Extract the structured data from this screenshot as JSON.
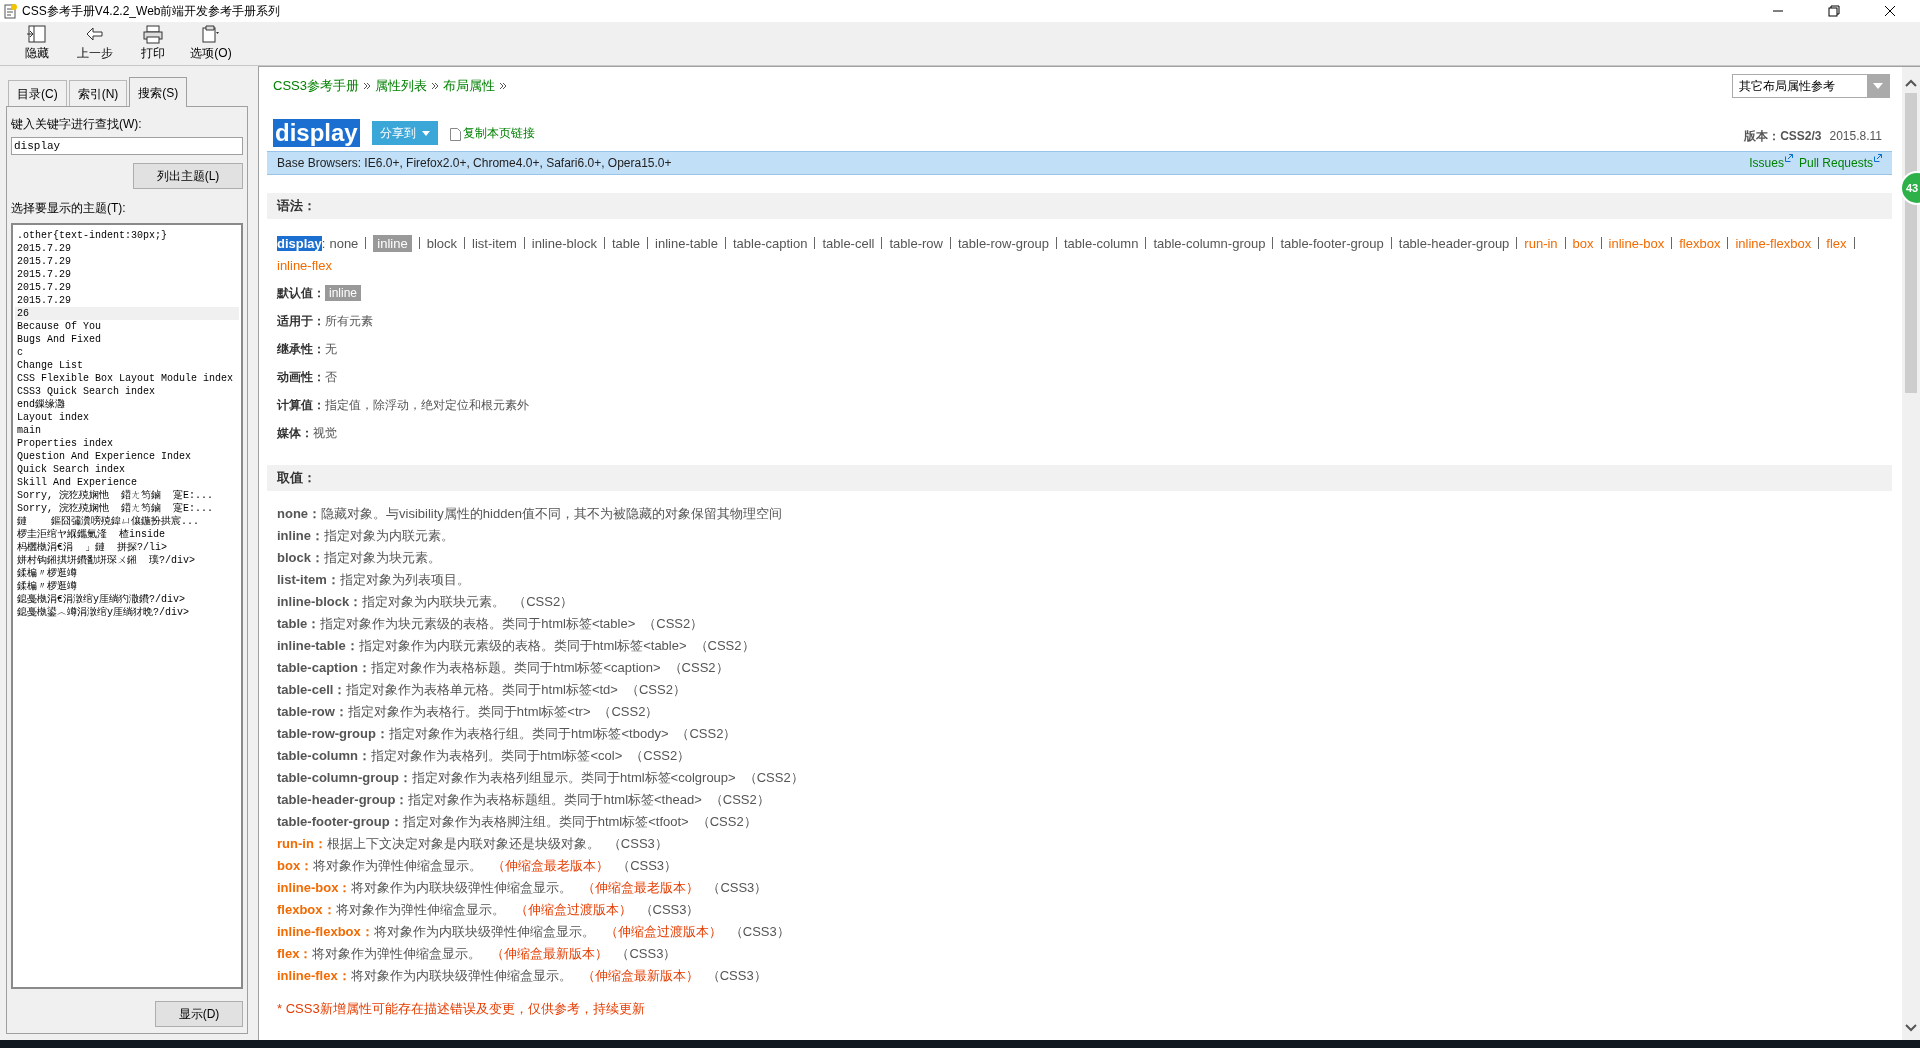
{
  "window": {
    "title": "CSS参考手册V4.2.2_Web前端开发参考手册系列"
  },
  "toolbar": [
    {
      "label": "隐藏"
    },
    {
      "label": "上一步"
    },
    {
      "label": "打印"
    },
    {
      "label": "选项(O)"
    }
  ],
  "nav_tabs": [
    {
      "label": "目录(C)",
      "selected": false
    },
    {
      "label": "索引(N)",
      "selected": false
    },
    {
      "label": "搜索(S)",
      "selected": true
    }
  ],
  "search": {
    "label": "键入关键字进行查找(W):",
    "value": "display",
    "list_button": "列出主题(L)",
    "topics_label": "选择要显示的主题(T):",
    "topics": [
      {
        "text": ".other{text-indent:30px;}",
        "selected": false
      },
      {
        "text": "2015.7.29",
        "selected": false
      },
      {
        "text": "2015.7.29",
        "selected": false
      },
      {
        "text": "2015.7.29",
        "selected": false
      },
      {
        "text": "2015.7.29",
        "selected": false
      },
      {
        "text": "2015.7.29",
        "selected": false
      },
      {
        "text": "26",
        "selected": true
      },
      {
        "text": "Because Of You",
        "selected": false
      },
      {
        "text": "Bugs And Fixed",
        "selected": false
      },
      {
        "text": "c",
        "selected": false
      },
      {
        "text": "Change List",
        "selected": false
      },
      {
        "text": "CSS Flexible Box Layout Module index",
        "selected": false
      },
      {
        "text": "CSS3 Quick Search index",
        "selected": false
      },
      {
        "text": "end鏁缘灉",
        "selected": false
      },
      {
        "text": "Layout index",
        "selected": false
      },
      {
        "text": "main",
        "selected": false
      },
      {
        "text": "Properties index",
        "selected": false
      },
      {
        "text": "Question And Experience Index",
        "selected": false
      },
      {
        "text": "Quick Search index",
        "selected": false
      },
      {
        "text": "Skill And Experience",
        "selected": false
      },
      {
        "text": "Sorry, 浣犵殑娴忚  鍣ㄤ笉鏀  寔E:...",
        "selected": false
      },
      {
        "text": "Sorry, 浣犵殑娴忚  鍣ㄤ笉鏀  寔E:...",
        "selected": false
      },
      {
        "text": "鏈    鏂囧彇瀵嗙殑鍏ㄩ儴鍦扮拱宸...",
        "selected": false
      },
      {
        "text": "椤圭洰绾ヤ緥鑴氭湰  楂inside",
        "selected": false
      },
      {
        "text": "杩欐槸涓€涓  」鏈  拼探?/li>",
        "selected": false
      },
      {
        "text": "姘村钩鎺掑垪鐨勫垪琛ㄨ鎺  璞?/div>",
        "selected": false
      },
      {
        "text": "鍒楄〃椤逛竴",
        "selected": false
      },
      {
        "text": "鍒楄〃椤逛竴",
        "selected": false
      },
      {
        "text": "鎴戞槸涓€涓潡绾у厓绱犳潵鐨?/div>",
        "selected": false
      },
      {
        "text": "鎴戞槸鍙︿竴涓潡绾у厓绱犲晩?/div>",
        "selected": false
      }
    ],
    "display_button": "显示(D)"
  },
  "breadcrumb": [
    "CSS3参考手册",
    "属性列表",
    "布局属性"
  ],
  "related_select": "其它布局属性参考",
  "heading": {
    "title": "display",
    "share": "分享到",
    "copy_link": "复制本页链接",
    "version_label": "版本：",
    "version": "CSS2/3",
    "date": "2015.8.11"
  },
  "browsers": {
    "text": "Base Browsers: IE6.0+, Firefox2.0+, Chrome4.0+, Safari6.0+, Opera15.0+",
    "links": [
      "Issues",
      "Pull Requests"
    ]
  },
  "side_badge": "43",
  "syntax": {
    "heading": "语法：",
    "property": "display",
    "colon": ":",
    "values": [
      {
        "text": "none",
        "kind": "css2",
        "highlighted": false
      },
      {
        "text": "inline",
        "kind": "css2",
        "highlighted": true
      },
      {
        "text": "block",
        "kind": "css2",
        "highlighted": false
      },
      {
        "text": "list-item",
        "kind": "css2",
        "highlighted": false
      },
      {
        "text": "inline-block",
        "kind": "css2",
        "highlighted": false
      },
      {
        "text": "table",
        "kind": "css2",
        "highlighted": false
      },
      {
        "text": "inline-table",
        "kind": "css2",
        "highlighted": false
      },
      {
        "text": "table-caption",
        "kind": "css2",
        "highlighted": false
      },
      {
        "text": "table-cell",
        "kind": "css2",
        "highlighted": false
      },
      {
        "text": "table-row",
        "kind": "css2",
        "highlighted": false
      },
      {
        "text": "table-row-group",
        "kind": "css2",
        "highlighted": false
      },
      {
        "text": "table-column",
        "kind": "css2",
        "highlighted": false
      },
      {
        "text": "table-column-group",
        "kind": "css2",
        "highlighted": false
      },
      {
        "text": "table-footer-group",
        "kind": "css2",
        "highlighted": false
      },
      {
        "text": "table-header-group",
        "kind": "css2",
        "highlighted": false
      },
      {
        "text": "run-in",
        "kind": "css3",
        "highlighted": false
      },
      {
        "text": "box",
        "kind": "css3",
        "highlighted": false
      },
      {
        "text": "inline-box",
        "kind": "css3",
        "highlighted": false
      },
      {
        "text": "flexbox",
        "kind": "css3",
        "highlighted": false
      },
      {
        "text": "inline-flexbox",
        "kind": "css3",
        "highlighted": false
      },
      {
        "text": "flex",
        "kind": "css3",
        "highlighted": false
      },
      {
        "text": "inline-flex",
        "kind": "css3",
        "highlighted": false
      }
    ],
    "attributes": [
      {
        "label": "默认值：",
        "value": "inline",
        "kind": "badge"
      },
      {
        "label": "适用于：",
        "value": "所有元素",
        "kind": "text"
      },
      {
        "label": "继承性：",
        "value": "无",
        "kind": "text"
      },
      {
        "label": "动画性：",
        "value": "否",
        "kind": "text"
      },
      {
        "label": "计算值：",
        "value": "指定值，除浮动，绝对定位和根元素外",
        "kind": "text"
      },
      {
        "label": "媒体：",
        "value": "视觉",
        "kind": "text"
      }
    ]
  },
  "values": {
    "heading": "取值：",
    "items": [
      {
        "term": "none：",
        "description": "隐藏对象。与visibility属性的hidden值不同，其不为被隐藏的对象保留其物理空间",
        "kind": "css2"
      },
      {
        "term": "inline：",
        "description": "指定对象为内联元素。",
        "kind": "css2"
      },
      {
        "term": "block：",
        "description": "指定对象为块元素。",
        "kind": "css2"
      },
      {
        "term": "list-item：",
        "description": "指定对象为列表项目。",
        "kind": "css2"
      },
      {
        "term": "inline-block：",
        "description": "指定对象为内联块元素。",
        "version": "（CSS2）",
        "kind": "css2"
      },
      {
        "term": "table：",
        "description": "指定对象作为块元素级的表格。类同于html标签<table>",
        "version": "（CSS2）",
        "kind": "css2"
      },
      {
        "term": "inline-table：",
        "description": "指定对象作为内联元素级的表格。类同于html标签<table>",
        "version": "（CSS2）",
        "kind": "css2"
      },
      {
        "term": "table-caption：",
        "description": "指定对象作为表格标题。类同于html标签<caption>",
        "version": "（CSS2）",
        "kind": "css2"
      },
      {
        "term": "table-cell：",
        "description": "指定对象作为表格单元格。类同于html标签<td>",
        "version": "（CSS2）",
        "kind": "css2"
      },
      {
        "term": "table-row：",
        "description": "指定对象作为表格行。类同于html标签<tr>",
        "version": "（CSS2）",
        "kind": "css2"
      },
      {
        "term": "table-row-group：",
        "description": "指定对象作为表格行组。类同于html标签<tbody>",
        "version": "（CSS2）",
        "kind": "css2"
      },
      {
        "term": "table-column：",
        "description": "指定对象作为表格列。类同于html标签<col>",
        "version": "（CSS2）",
        "kind": "css2"
      },
      {
        "term": "table-column-group：",
        "description": "指定对象作为表格列组显示。类同于html标签<colgroup>",
        "version": "（CSS2）",
        "kind": "css2"
      },
      {
        "term": "table-header-group：",
        "description": "指定对象作为表格标题组。类同于html标签<thead>",
        "version": "（CSS2）",
        "kind": "css2"
      },
      {
        "term": "table-footer-group：",
        "description": "指定对象作为表格脚注组。类同于html标签<tfoot>",
        "version": "（CSS2）",
        "kind": "css2"
      },
      {
        "term": "run-in：",
        "description": "根据上下文决定对象是内联对象还是块级对象。",
        "version": "（CSS3）",
        "kind": "css3"
      },
      {
        "term": "box：",
        "description": "将对象作为弹性伸缩盒显示。",
        "note": "（伸缩盒最老版本）",
        "version": "（CSS3）",
        "kind": "css3"
      },
      {
        "term": "inline-box：",
        "description": "将对象作为内联块级弹性伸缩盒显示。",
        "note": "（伸缩盒最老版本）",
        "version": "（CSS3）",
        "kind": "css3"
      },
      {
        "term": "flexbox：",
        "description": "将对象作为弹性伸缩盒显示。",
        "note": "（伸缩盒过渡版本）",
        "version": "（CSS3）",
        "kind": "css3"
      },
      {
        "term": "inline-flexbox：",
        "description": "将对象作为内联块级弹性伸缩盒显示。",
        "note": "（伸缩盒过渡版本）",
        "version": "（CSS3）",
        "kind": "css3"
      },
      {
        "term": "flex：",
        "description": "将对象作为弹性伸缩盒显示。",
        "note": "（伸缩盒最新版本）",
        "version": "（CSS3）",
        "kind": "css3"
      },
      {
        "term": "inline-flex：",
        "description": "将对象作为内联块级弹性伸缩盒显示。",
        "note": "（伸缩盒最新版本）",
        "version": "（CSS3）",
        "kind": "css3"
      }
    ],
    "footnote": "* CSS3新增属性可能存在描述错误及变更，仅供参考，持续更新"
  }
}
